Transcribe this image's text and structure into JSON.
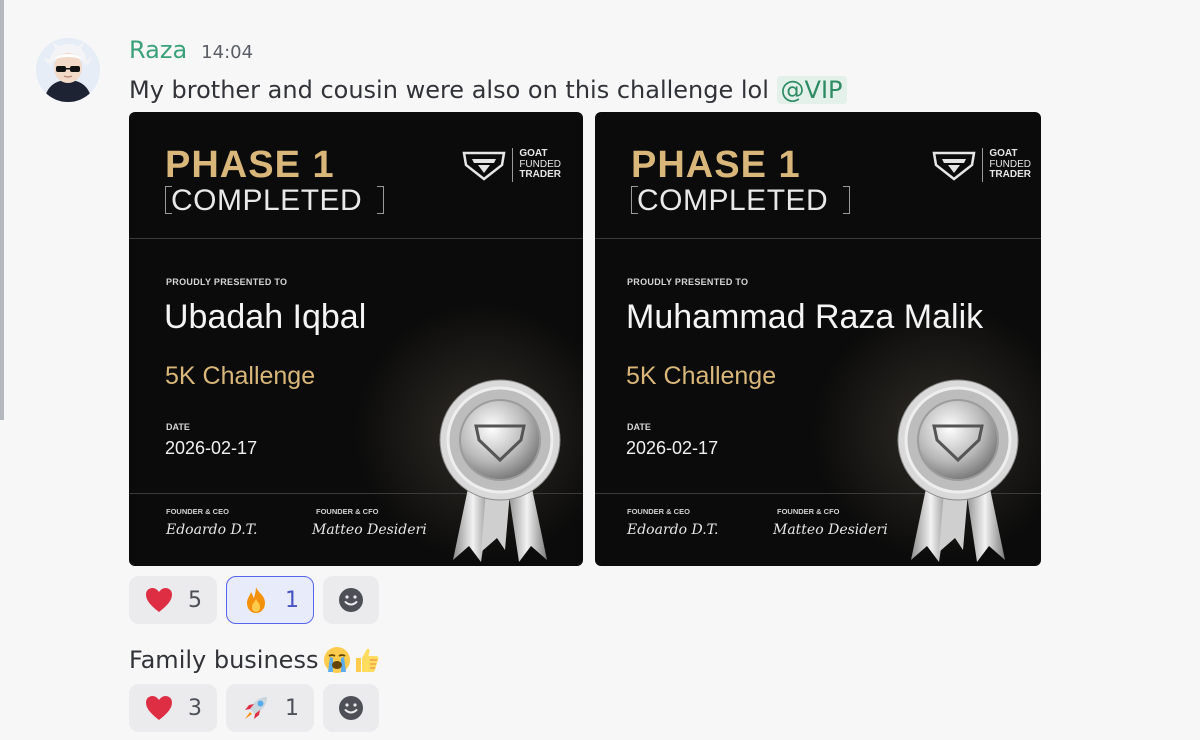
{
  "message": {
    "username": "Raza",
    "timestamp": "14:04",
    "text": "My brother and cousin were also on this challenge lol",
    "mention": "@VIP"
  },
  "certificates": [
    {
      "phase": "PHASE 1",
      "status": "COMPLETED",
      "brand_lines": [
        "GOAT",
        "FUNDED",
        "TRADER"
      ],
      "presented_label": "PROUDLY PRESENTED TO",
      "recipient": "Ubadah Iqbal",
      "challenge": "5K Challenge",
      "date_label": "DATE",
      "date": "2026-02-17",
      "role_1": "FOUNDER & CEO",
      "signature_1": "Edoardo D.T.",
      "role_2": "FOUNDER & CFO",
      "signature_2": "Matteo Desideri"
    },
    {
      "phase": "PHASE 1",
      "status": "COMPLETED",
      "brand_lines": [
        "GOAT",
        "FUNDED",
        "TRADER"
      ],
      "presented_label": "PROUDLY PRESENTED TO",
      "recipient": "Muhammad Raza Malik",
      "challenge": "5K Challenge",
      "date_label": "DATE",
      "date": "2026-02-17",
      "role_1": "FOUNDER & CEO",
      "signature_1": "Edoardo D.T.",
      "role_2": "FOUNDER & CFO",
      "signature_2": "Matteo Desideri"
    }
  ],
  "reactions_first": [
    {
      "emoji": "heart-icon",
      "count": "5",
      "active": false
    },
    {
      "emoji": "fire-icon",
      "count": "1",
      "active": true
    }
  ],
  "second_message": {
    "text": "Family business",
    "emojis": [
      "loudly-crying-face-icon",
      "thumbs-up-icon"
    ]
  },
  "reactions_second": [
    {
      "emoji": "heart-icon",
      "count": "3",
      "active": false
    },
    {
      "emoji": "rocket-icon",
      "count": "1",
      "active": false
    }
  ],
  "colors": {
    "username": "#3aa17a",
    "gold": "#d9b77a",
    "active_reaction_border": "#5865f2"
  }
}
